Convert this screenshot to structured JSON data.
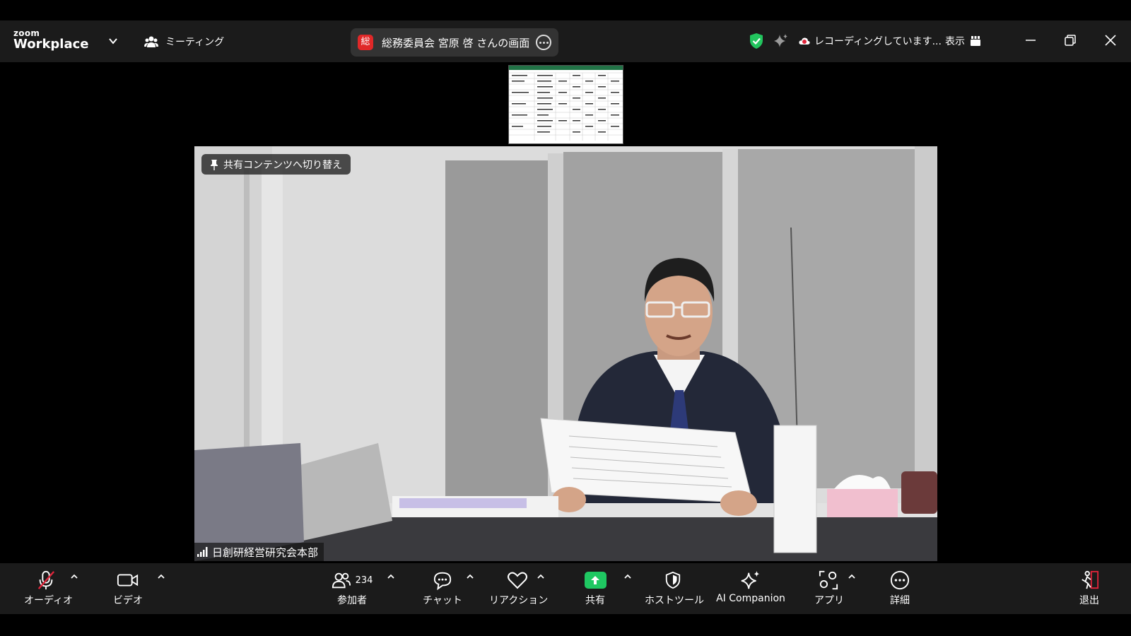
{
  "topbar": {
    "logo_small": "zoom",
    "logo_big": "Workplace",
    "meeting_label": "ミーティング",
    "share_badge": "総",
    "share_title": "総務委員会 宮原 啓 さんの画面",
    "recording_label": "レコーディングしています...",
    "view_label": "表示"
  },
  "video": {
    "pin_label": "共有コンテンツへ切り替え",
    "participant_name": "日創研経営研究会本部"
  },
  "toolbar": {
    "audio_label": "オーディオ",
    "video_label": "ビデオ",
    "participants_label": "参加者",
    "participants_count": "234",
    "chat_label": "チャット",
    "reaction_label": "リアクション",
    "share_label": "共有",
    "host_tools_label": "ホストツール",
    "ai_label": "AI Companion",
    "apps_label": "アプリ",
    "more_label": "詳細",
    "leave_label": "退出"
  },
  "colors": {
    "topbar_bg": "#1b1b1b",
    "share_green": "#1fc862",
    "badge_red": "#e02828",
    "shield_green": "#22c55e",
    "muted_red": "#e0243a"
  }
}
